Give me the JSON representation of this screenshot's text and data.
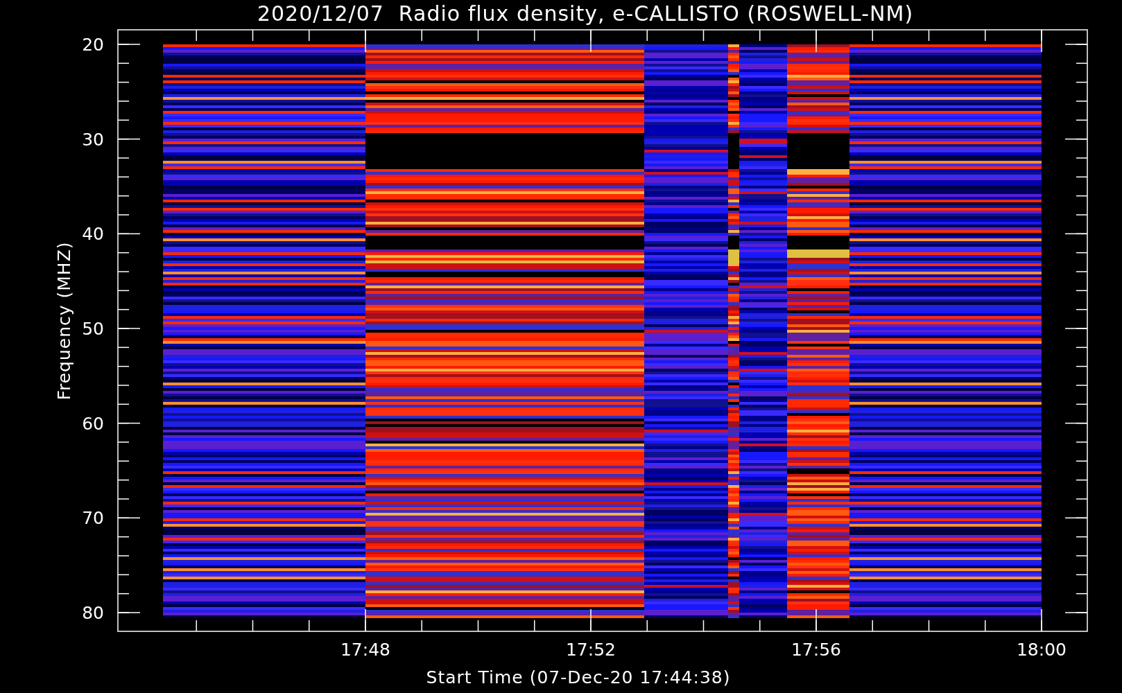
{
  "plot": {
    "title": "2020/12/07  Radio flux density, e-CALLISTO (ROSWELL-NM)",
    "y_axis": {
      "label": "Frequency (MHZ)",
      "ticks": [
        "20",
        "30",
        "40",
        "50",
        "60",
        "70",
        "80"
      ]
    },
    "x_axis": {
      "label": "Start Time (07-Dec-20 17:44:38)",
      "ticks": [
        "17:48",
        "17:52",
        "17:56",
        "18:00"
      ]
    }
  }
}
